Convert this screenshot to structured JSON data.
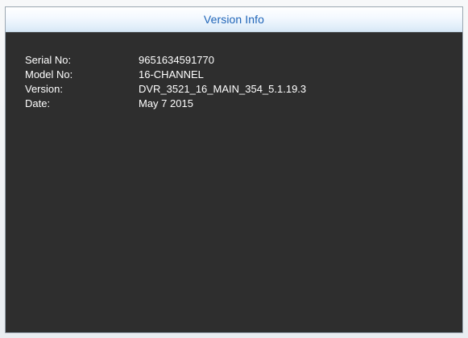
{
  "window": {
    "title": "Version Info"
  },
  "info": {
    "rows": [
      {
        "label": "Serial No:",
        "value": "9651634591770"
      },
      {
        "label": "Model No:",
        "value": "16-CHANNEL"
      },
      {
        "label": "Version:",
        "value": "DVR_3521_16_MAIN_354_5.1.19.3"
      },
      {
        "label": "Date:",
        "value": "May  7 2015"
      }
    ]
  }
}
